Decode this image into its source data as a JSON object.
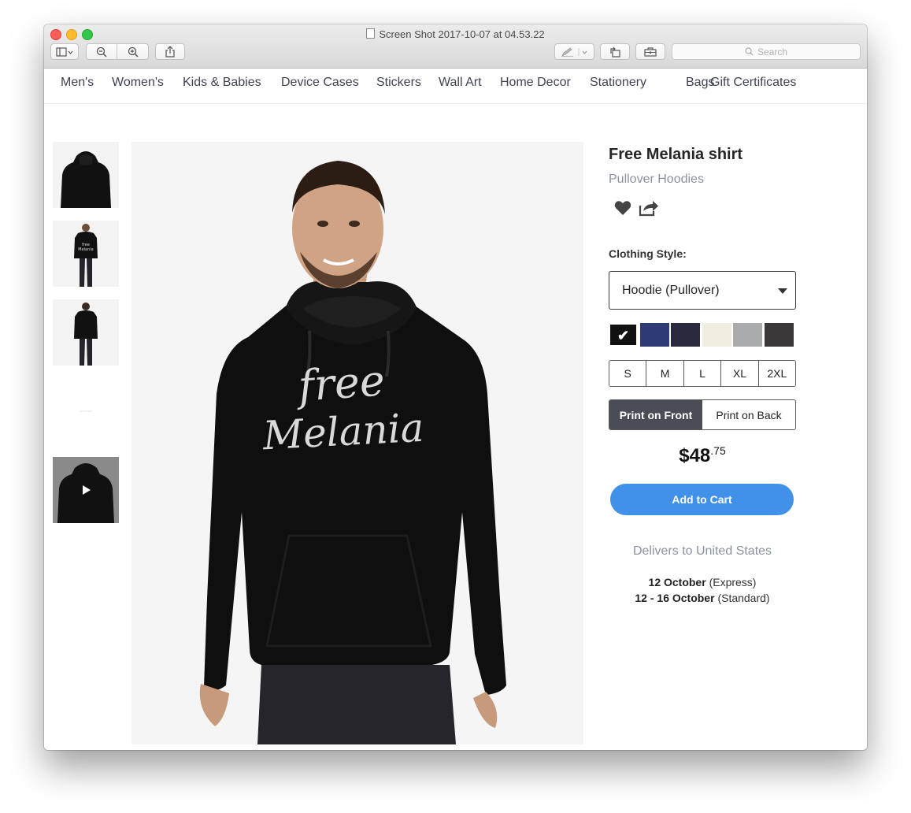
{
  "window": {
    "title": "Screen Shot 2017-10-07 at 04.53.22",
    "search_placeholder": "Search"
  },
  "nav": {
    "items": [
      "Men's",
      "Women's",
      "Kids & Babies",
      "Device Cases",
      "Stickers",
      "Wall Art",
      "Home Decor",
      "Stationery",
      "Bags",
      "Gift Certificates"
    ]
  },
  "product": {
    "title": "Free Melania shirt",
    "category": "Pullover Hoodies",
    "print_text_line1": "free",
    "print_text_line2": "Melania",
    "clothing_style_label": "Clothing Style:",
    "clothing_style_value": "Hoodie (Pullover)",
    "colors": [
      "#111111",
      "#2e3a73",
      "#2a2a3e",
      "#f0ede1",
      "#a9abad",
      "#3a3838"
    ],
    "selected_color_index": 0,
    "sizes": [
      "S",
      "M",
      "L",
      "XL",
      "2XL"
    ],
    "print_options": [
      "Print on Front",
      "Print on Back"
    ],
    "selected_print": "Print on Front",
    "price_dollars": "$48",
    "price_cents": ".75",
    "add_to_cart": "Add to Cart",
    "delivers_to": "Delivers to United States",
    "delivery": [
      {
        "dates": "12 October",
        "method": "(Express)"
      },
      {
        "dates": "12 - 16 October",
        "method": "(Standard)"
      }
    ]
  },
  "icons": {
    "favorite": "heart-icon",
    "share": "share-icon",
    "play": "play-icon",
    "check": "check-icon"
  }
}
